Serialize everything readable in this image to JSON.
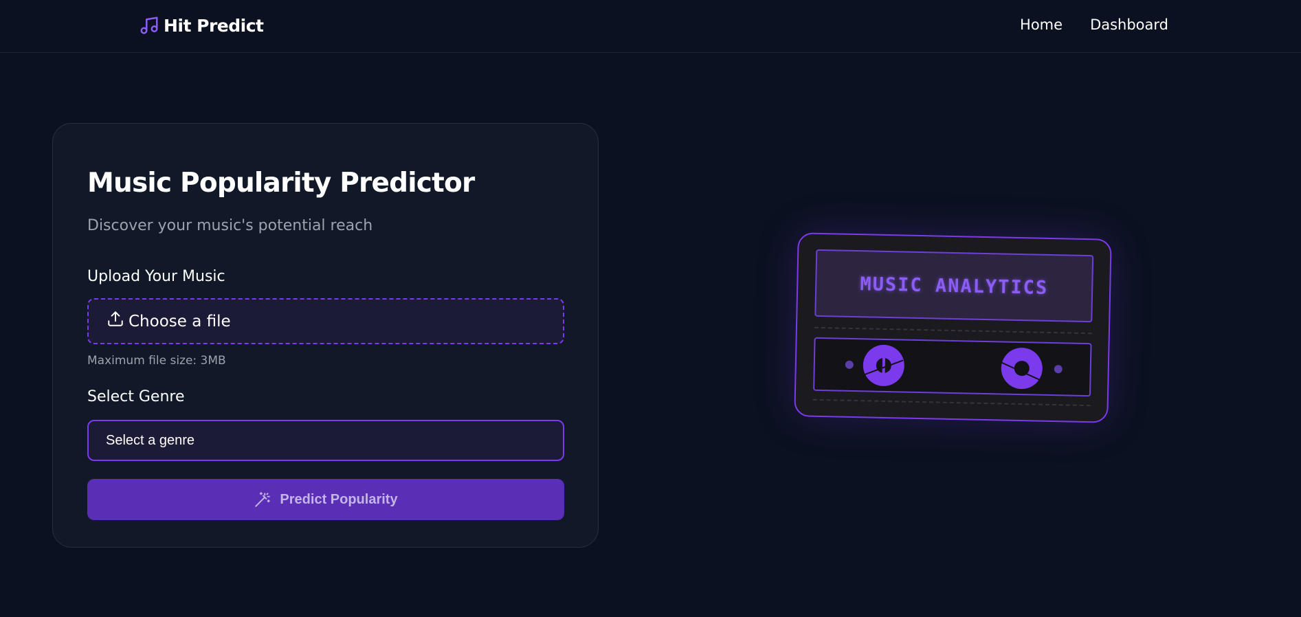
{
  "nav": {
    "brand": "Hit Predict",
    "brand_icon": "music-note-icon",
    "links": [
      {
        "label": "Home"
      },
      {
        "label": "Dashboard"
      }
    ]
  },
  "form": {
    "title": "Music Popularity Predictor",
    "subtitle": "Discover your music's potential reach",
    "upload_label": "Upload Your Music",
    "upload_button": "Choose a file",
    "upload_icon": "upload-icon",
    "file_hint": "Maximum file size: 3MB",
    "genre_label": "Select Genre",
    "genre_value": "Select a genre",
    "submit_label": "Predict Popularity",
    "submit_icon": "magic-wand-icon"
  },
  "illustration": {
    "screen_text": "MUSIC ANALYTICS"
  },
  "colors": {
    "background": "#0b1120",
    "card": "#111827",
    "accent": "#7c3aed",
    "button": "#5b2fb5",
    "muted_text": "#9ca3af"
  }
}
